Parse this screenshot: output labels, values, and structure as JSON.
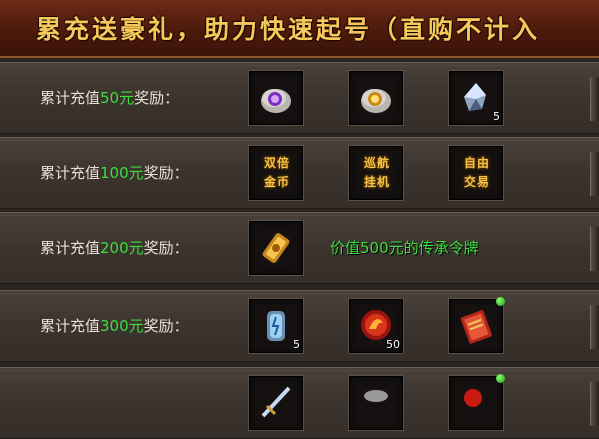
{
  "banner": {
    "title": "累充送豪礼，助力快速起号（直购不计入"
  },
  "rows": [
    {
      "label_prefix": "累计充值",
      "amount": "50元",
      "label_suffix": "奖励：",
      "items": [
        {
          "icon": "purple-rune-stone-icon",
          "count": ""
        },
        {
          "icon": "gold-rune-stone-icon",
          "count": ""
        },
        {
          "icon": "crystal-ore-icon",
          "count": "5"
        }
      ]
    },
    {
      "label_prefix": "累计充值",
      "amount": "100元",
      "label_suffix": "奖励：",
      "items": [
        {
          "icon": "text-badge-icon",
          "line1": "双倍",
          "line2": "金币"
        },
        {
          "icon": "text-badge-icon",
          "line1": "巡航",
          "line2": "挂机"
        },
        {
          "icon": "text-badge-icon",
          "line1": "自由",
          "line2": "交易"
        }
      ]
    },
    {
      "label_prefix": "累计充值",
      "amount": "200元",
      "label_suffix": "奖励：",
      "items": [
        {
          "icon": "golden-token-icon",
          "count": ""
        }
      ],
      "description": "价值500元的传承令牌"
    },
    {
      "label_prefix": "累计充值",
      "amount": "300元",
      "label_suffix": "奖励：",
      "items": [
        {
          "icon": "blue-rune-stone-icon",
          "count": "5"
        },
        {
          "icon": "fire-orb-icon",
          "count": "50"
        },
        {
          "icon": "red-book-icon",
          "count": ""
        }
      ]
    }
  ]
}
